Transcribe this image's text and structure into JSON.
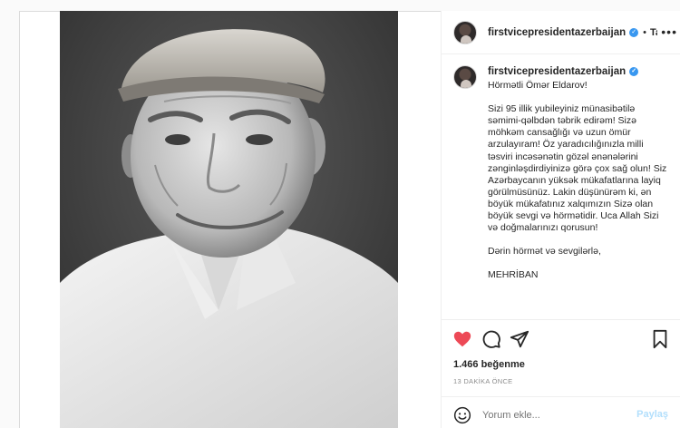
{
  "post": {
    "photo_alt": "",
    "author": {
      "username": "firstvicepresidentazerbaijan",
      "verified": true,
      "follow_label": "Ta",
      "separator": "•"
    },
    "more_label": "•••",
    "caption": {
      "username": "firstvicepresidentazerbaijan",
      "paragraphs": [
        "Hörmətli Ömər Eldarov!",
        "Sizi 95 illik yubileyiniz münasibətilə səmimi-qəlbdən təbrik edirəm! Sizə möhkəm cansağlığı və uzun ömür arzulayıram! Öz yaradıcılığınızla milli təsviri incəsənətin gözəl ənənələrini zənginləşdirdiyinizə görə çox sağ olun! Siz Azərbaycanın yüksək mükafatlarına layiq görülmüsünüz. Lakin düşünürəm ki, ən böyük mükafatınız xalqımızın Sizə olan böyük sevgi və hörmətidir. Uca Allah Sizi və doğmalarınızı qorusun!",
        "Dərin hörmət və sevgilərlə,",
        "MEHRİBAN"
      ]
    },
    "likes": "1.466 beğenme",
    "time_ago": "13 DAKİKA ÖNCE",
    "comment": {
      "placeholder": "Yorum ekle...",
      "post_label": "Paylaş"
    },
    "icons": [
      "heart-icon",
      "comment-icon",
      "share-icon",
      "bookmark-icon",
      "emoji-icon"
    ],
    "colors": {
      "liked": "#ed4956",
      "link": "#3897f0",
      "post_disabled": "#b2dffc"
    }
  }
}
